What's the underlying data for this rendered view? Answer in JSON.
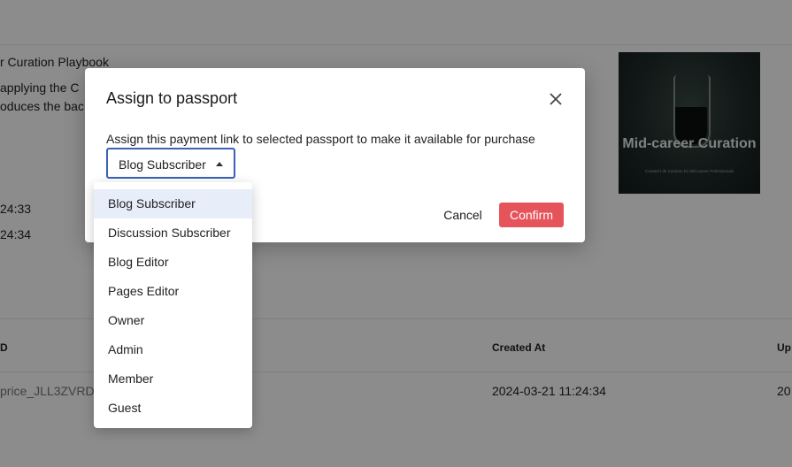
{
  "background": {
    "playbook_title": "r Curation Playbook",
    "desc_line1": "applying the C",
    "desc_line2": "oduces the bac",
    "time1": "24:33",
    "time2": "24:34",
    "cover": {
      "title": "Mid-career Curation",
      "subtitle": "Curated Life Curation for Mid-career Professionals"
    },
    "table": {
      "headers": {
        "id": "D",
        "created_at": "Created At",
        "updated_at": "Up"
      },
      "row": {
        "id": "price_JLL3ZVRDy",
        "created_at": "2024-03-21 11:24:34",
        "updated_at": "20"
      }
    }
  },
  "modal": {
    "title": "Assign to passport",
    "description": "Assign this payment link to selected passport to make it available for purchase",
    "select": {
      "value": "Blog Subscriber"
    },
    "cancel_label": "Cancel",
    "confirm_label": "Confirm"
  },
  "dropdown": {
    "options": [
      {
        "label": "Blog Subscriber",
        "selected": true
      },
      {
        "label": "Discussion Subscriber"
      },
      {
        "label": "Blog Editor"
      },
      {
        "label": "Pages Editor"
      },
      {
        "label": "Owner"
      },
      {
        "label": "Admin"
      },
      {
        "label": "Member"
      },
      {
        "label": "Guest"
      }
    ]
  },
  "colors": {
    "accent": "#3a62b5",
    "confirm": "#e5545b",
    "selected_option_bg": "#e8edfa"
  }
}
